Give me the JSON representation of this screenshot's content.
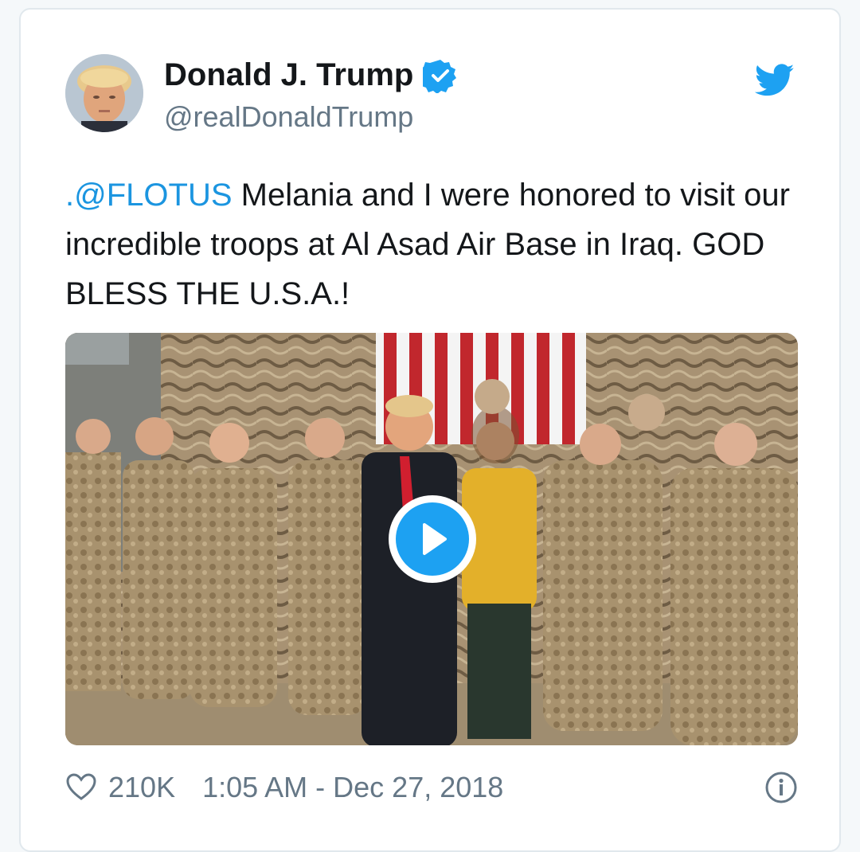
{
  "tweet": {
    "author_name": "Donald J. Trump",
    "handle": "@realDonaldTrump",
    "mention": ".@FLOTUS",
    "text": " Melania and I were honored to visit our incredible troops at Al Asad Air Base in Iraq. GOD BLESS THE U.S.A.!",
    "likes": "210K",
    "timestamp": "1:05 AM - Dec 27, 2018"
  },
  "icons": {
    "verified": "verified-badge-icon",
    "brand": "twitter-bird-icon",
    "like": "heart-icon",
    "play": "play-icon",
    "info": "info-icon"
  },
  "colors": {
    "accent": "#1da1f2",
    "mention": "#1b95e0",
    "text": "#14171a",
    "muted": "#657786"
  }
}
